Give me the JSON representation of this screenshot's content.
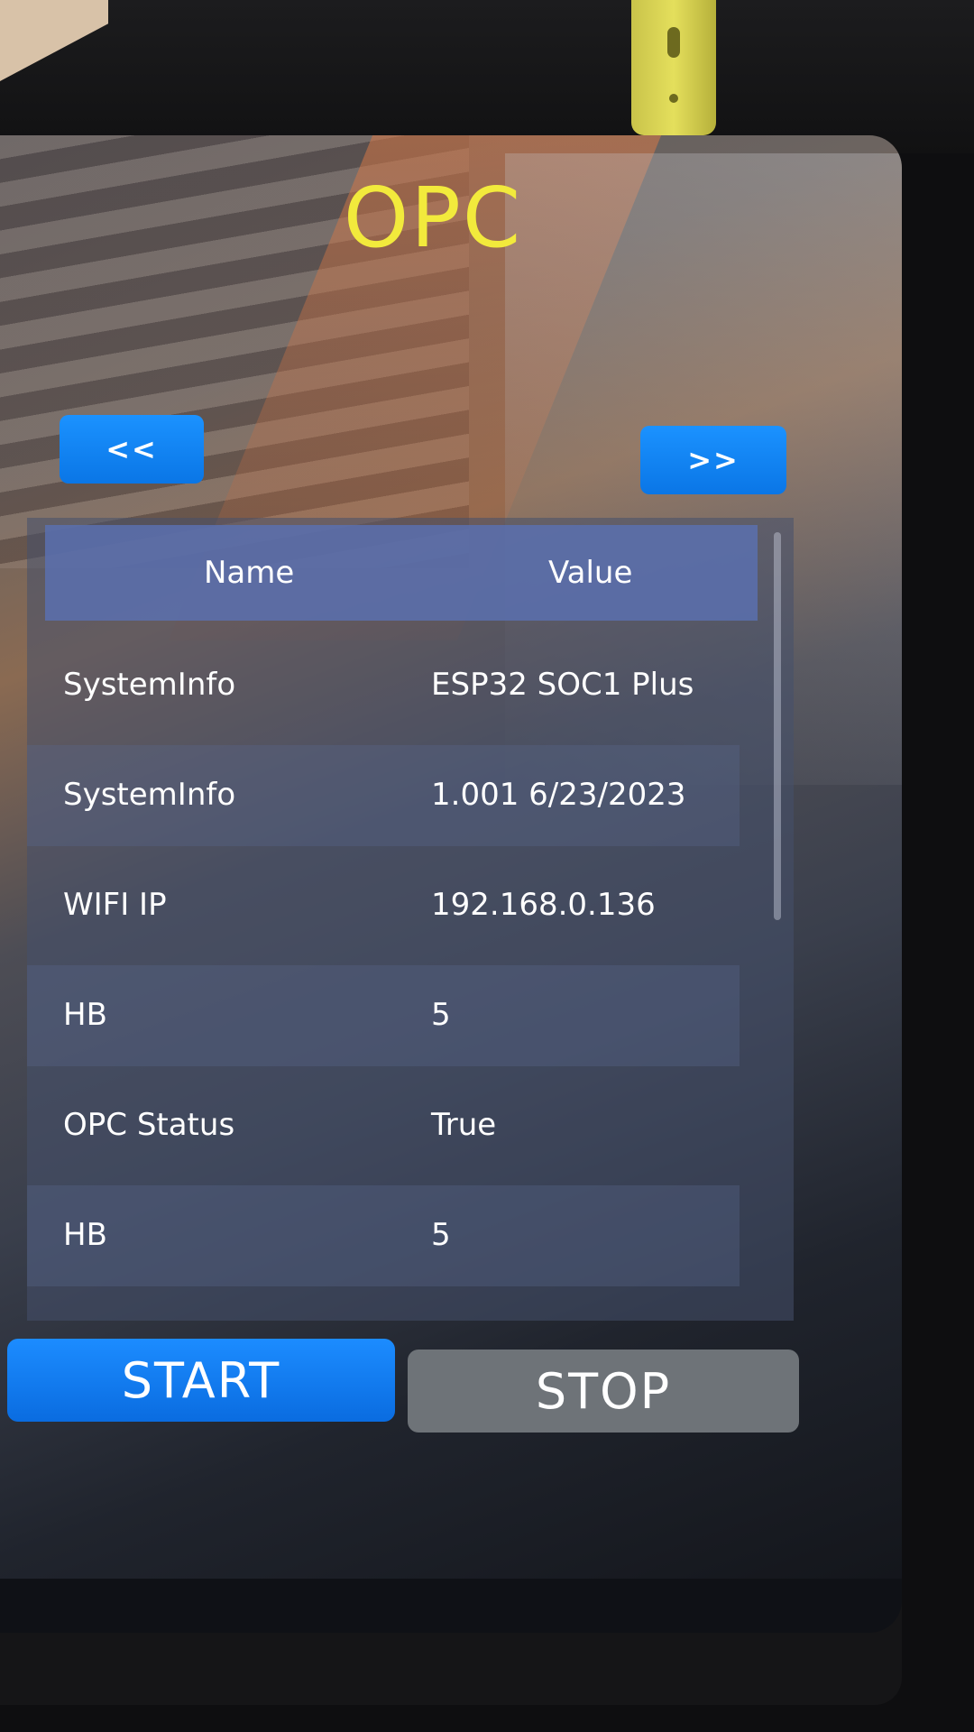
{
  "screen": {
    "title": "OPC",
    "nav": {
      "prev_label": "<<",
      "next_label": ">>"
    },
    "table": {
      "columns": [
        "Name",
        "Value"
      ],
      "rows": [
        {
          "name": "SystemInfo",
          "value": "ESP32 SOC1 Plus"
        },
        {
          "name": "SystemInfo",
          "value": "1.001 6/23/2023"
        },
        {
          "name": "WIFI IP",
          "value": "192.168.0.136"
        },
        {
          "name": "HB",
          "value": "5"
        },
        {
          "name": "OPC Status",
          "value": "True"
        },
        {
          "name": "HB",
          "value": "5"
        }
      ]
    },
    "actions": {
      "start_label": "START",
      "stop_label": "STOP"
    }
  },
  "colors": {
    "title": "#f2ea3c",
    "primary_button": "#0a76e6",
    "disabled_button": "#6e7378",
    "table_header": "#5a70af"
  }
}
